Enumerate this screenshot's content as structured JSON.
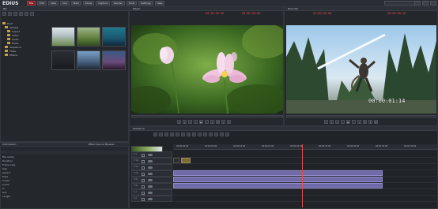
{
  "app": {
    "logo": "EDIUS"
  },
  "menu": [
    "File",
    "Edit",
    "View",
    "Clip",
    "Mark",
    "Mode",
    "Capture",
    "Render",
    "Tools",
    "Settings",
    "Help"
  ],
  "system_field": "",
  "bin": {
    "tab": "Bin",
    "tree": [
      "Root",
      "Sample",
      "Import",
      "Video",
      "Audio",
      "Photo",
      "Sequence",
      "Titles",
      "Effects"
    ],
    "thumbs": [
      {
        "label": ""
      },
      {
        "label": ""
      },
      {
        "label": ""
      },
      {
        "label": ""
      },
      {
        "label": ""
      },
      {
        "label": ""
      }
    ]
  },
  "props_bar": {
    "left": "Information",
    "right": "Effect   Source Browser"
  },
  "props": {
    "rows": [
      {
        "k": "File name",
        "v": ""
      },
      {
        "k": "Duration",
        "v": ""
      },
      {
        "k": "Frame rate",
        "v": ""
      },
      {
        "k": "Size",
        "v": ""
      },
      {
        "k": "Aspect",
        "v": ""
      },
      {
        "k": "Field",
        "v": ""
      },
      {
        "k": "Codec",
        "v": ""
      },
      {
        "k": "Audio",
        "v": ""
      },
      {
        "k": "In",
        "v": ""
      },
      {
        "k": "Out",
        "v": ""
      },
      {
        "k": "Length",
        "v": ""
      }
    ]
  },
  "source": {
    "tab": "Player",
    "tc_in": "00:00:00:00",
    "tc_out": "00:00:00:00"
  },
  "record": {
    "tab": "Recorder",
    "tc_in": "00:00:00:00",
    "tc_out": "00:00:00:00",
    "overlay_tc": "00:00:01:14"
  },
  "timeline": {
    "tab": "Sequence",
    "ruler": [
      "00:00:00:00",
      "00:00:05:00",
      "00:00:10:00",
      "00:00:15:00",
      "00:00:20:00",
      "00:00:25:00",
      "00:00:30:00",
      "00:00:35:00",
      "00:00:40:00"
    ],
    "tracks": [
      "1 V",
      "1 VA",
      "2 VA",
      "3 VA",
      "4 VA",
      "5 VA",
      "1 A",
      "2 A"
    ],
    "clips": [
      {
        "label": "",
        "style": "gold"
      },
      {
        "label": ""
      },
      {
        "label": ""
      },
      {
        "label": ""
      }
    ]
  }
}
